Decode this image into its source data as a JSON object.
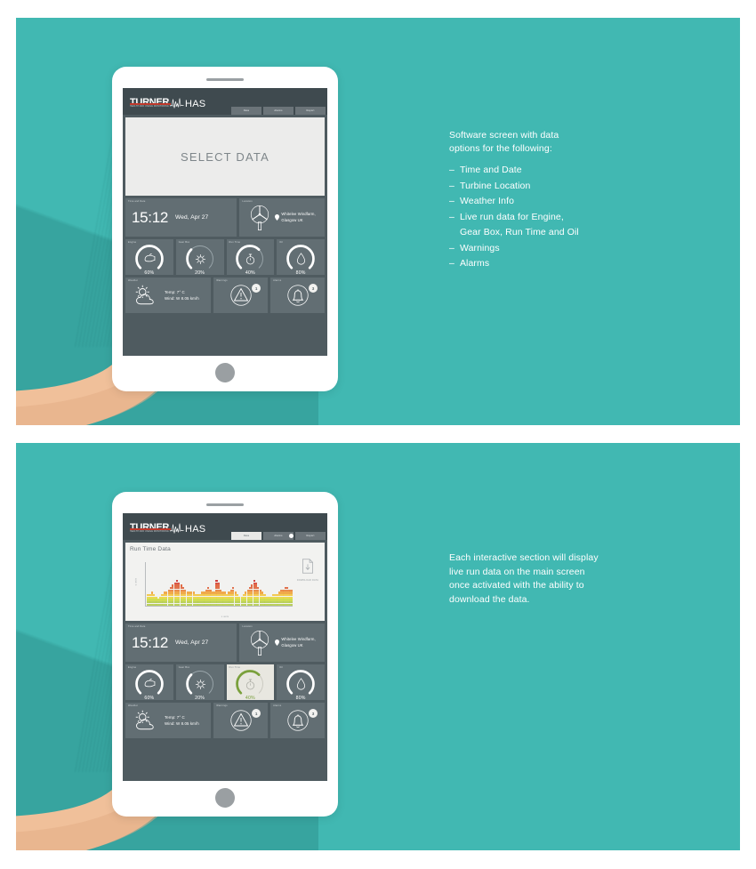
{
  "theme": {
    "panel_bg": "#41b8b2",
    "screen_bg": "#4f5b60",
    "header_bg": "#3f4a4f",
    "card_bg": "#626e73",
    "card_highlight_bg": "#e8e7e0",
    "accent_green": "#7aa03c",
    "logo_red": "#c0392b",
    "skin": "#f0c09a"
  },
  "app": {
    "logo_mark": "TURNER",
    "logo_suffix": "HAS",
    "logo_tagline": "HEALTH AND USAGE MONITORING SYSTEMS",
    "tabs": [
      {
        "label": "Data",
        "active_screen1": false,
        "active_screen2": true
      },
      {
        "label": "Alarms",
        "active_screen1": false,
        "active_screen2": false
      },
      {
        "label": "Report",
        "active_screen1": false,
        "active_screen2": false
      }
    ]
  },
  "screen1": {
    "select_data_label": "SELECT DATA"
  },
  "screen2": {
    "chart_title": "Run Time Data",
    "download_label": "DOWNLOAD DATA",
    "download_icon": "document-download-icon"
  },
  "widgets": {
    "time_label": "Time and Date",
    "time_value": "15:12",
    "date_value": "Wed, Apr 27",
    "location_label": "Location",
    "location_icon": "wind-turbine-icon",
    "pin_icon": "map-pin-icon",
    "location_line1": "Whitelee Windfarm,",
    "location_line2": "Glasgow UK",
    "gauges": [
      {
        "label": "Engine",
        "value": "60%",
        "percent": 60,
        "icon": "engine-icon",
        "highlighted": false
      },
      {
        "label": "Gear Box",
        "value": "20%",
        "percent": 20,
        "icon": "gear-icon",
        "highlighted": false
      },
      {
        "label": "Run Time",
        "value": "40%",
        "percent": 40,
        "icon": "stopwatch-icon",
        "highlighted_screen2": true
      },
      {
        "label": "Oil",
        "value": "80%",
        "percent": 80,
        "icon": "oil-drop-icon",
        "highlighted": false
      }
    ],
    "weather_label": "Weather",
    "weather_icon": "sun-cloud-icon",
    "weather_temp": "Temp: 7° C",
    "weather_wind": "Wind: W 8.05 km/h",
    "warning_label": "Warnings",
    "warning_icon": "warning-triangle-icon",
    "warning_count": "1",
    "alarm_label": "Alarms",
    "alarm_icon": "bell-icon",
    "alarm_count": "3"
  },
  "annotation1": {
    "lead_line1": "Software screen with data",
    "lead_line2": "options for the following:",
    "bullets": [
      "Time and Date",
      "Turbine Location",
      "Weather Info",
      "Live run data for Engine,\nGear Box, Run Time and Oil",
      "Warnings",
      "Alarms"
    ],
    "dash": "–"
  },
  "annotation2": {
    "line1": "Each interactive section will display",
    "line2": "live run data on the main screen",
    "line3": "once activated with the ability to",
    "line4": "download the data."
  },
  "chart_data": {
    "type": "bar",
    "title": "Run Time Data",
    "xlabel": "x axis",
    "ylabel": "y axis",
    "grid": false,
    "legend": false,
    "note": "Stacked dot-matrix column chart; each column height = number of stacked dots, colored low(green)→high(red)",
    "ylim": [
      0,
      13
    ],
    "values": [
      5,
      5,
      6,
      5,
      4,
      3,
      4,
      5,
      6,
      6,
      7,
      8,
      9,
      10,
      11,
      10,
      9,
      8,
      7,
      6,
      6,
      6,
      6,
      5,
      5,
      5,
      6,
      6,
      7,
      8,
      7,
      6,
      6,
      11,
      10,
      7,
      6,
      6,
      5,
      6,
      7,
      8,
      6,
      5,
      4,
      4,
      5,
      6,
      7,
      8,
      9,
      11,
      10,
      8,
      7,
      6,
      5,
      4,
      4,
      4,
      5,
      5,
      5,
      6,
      7,
      7,
      8,
      8,
      7,
      7
    ],
    "palette": [
      "#b8cf55",
      "#cddc4e",
      "#e8d94a",
      "#f2c84a",
      "#f0a848",
      "#ea8a46",
      "#e06a44",
      "#d94f42",
      "#cf3b3b"
    ]
  }
}
